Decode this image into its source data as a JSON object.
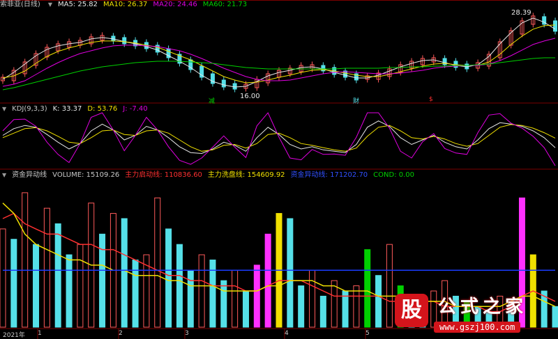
{
  "colors": {
    "bg": "#000000",
    "divider": "#7a0000",
    "grid": "#3a0000",
    "ma5": "#e8e8e8",
    "ma10": "#f0e000",
    "ma20": "#e000e0",
    "ma60": "#00d000",
    "up": "#ff5a5a",
    "down": "#55e0e8",
    "k": "#e8e8e8",
    "d": "#f0e000",
    "j": "#e000e0",
    "main_start": "#ff3030",
    "wash": "#f0e000",
    "fund": "#1a3cff",
    "cond": "#00d000"
  },
  "panel1": {
    "title": "索菲亚(日线)",
    "ma5": "MA5: 25.82",
    "ma10": "MA10: 26.37",
    "ma20": "MA20: 24.46",
    "ma60": "MA60: 21.73",
    "high_label": "28.39",
    "low_label": "16.00",
    "markers": [
      "减",
      "财",
      "$"
    ]
  },
  "panel2": {
    "title": "KDJ(9,3,3)",
    "k": "K: 33.37",
    "d": "D: 53.76",
    "j": "J: -7.40"
  },
  "panel3": {
    "title": "资金异动线",
    "volume": "VOLUME: 15109.26",
    "main_start": "主力启动线: 110836.60",
    "wash": "主力洗盘线: 154609.92",
    "fund": "资金异动线: 171202.70",
    "cond": "COND: 0.00"
  },
  "axis": {
    "labels": [
      "2021年",
      "1",
      "2",
      "3",
      "4",
      "5"
    ]
  },
  "watermark": {
    "logo_char": "股",
    "title": "公式之家",
    "url": "www.gszj100.com"
  },
  "chart_data": [
    {
      "type": "line",
      "title": "索菲亚(日线)",
      "price_range": [
        16.0,
        28.39
      ],
      "series": [
        {
          "name": "MA5",
          "values": [
            18.6,
            19.6,
            20.8,
            22.0,
            22.9,
            23.4,
            23.7,
            23.9,
            24.4,
            24.6,
            24.4,
            24.0,
            23.7,
            23.3,
            22.8,
            22.0,
            21.2,
            20.3,
            19.2,
            18.3,
            17.8,
            17.5,
            17.6,
            18.3,
            19.1,
            19.6,
            19.9,
            20.3,
            20.4,
            20.1,
            19.6,
            19.2,
            18.8,
            18.8,
            19.2,
            19.8,
            20.4,
            20.9,
            21.3,
            21.4,
            21.0,
            20.6,
            20.4,
            20.7,
            21.9,
            23.7,
            25.3,
            26.7,
            27.4,
            26.8,
            25.8
          ]
        },
        {
          "name": "MA10",
          "values": [
            18.8,
            19.1,
            19.8,
            20.9,
            21.9,
            22.6,
            23.1,
            23.5,
            23.9,
            24.1,
            24.1,
            24.0,
            23.8,
            23.5,
            23.2,
            22.6,
            22.0,
            21.4,
            20.6,
            19.8,
            19.0,
            18.5,
            18.1,
            18.2,
            18.5,
            18.9,
            19.2,
            19.6,
            19.9,
            20.0,
            19.8,
            19.5,
            19.2,
            19.0,
            19.0,
            19.3,
            19.7,
            20.1,
            20.5,
            20.8,
            20.9,
            20.7,
            20.6,
            20.6,
            21.1,
            22.2,
            23.6,
            24.8,
            25.8,
            26.3,
            26.4
          ]
        },
        {
          "name": "MA20",
          "values": [
            17.6,
            17.9,
            18.4,
            19.3,
            20.2,
            21.0,
            21.7,
            22.3,
            22.7,
            23.1,
            23.4,
            23.5,
            23.5,
            23.4,
            23.3,
            23.0,
            22.7,
            22.2,
            21.6,
            20.9,
            20.2,
            19.6,
            19.0,
            18.6,
            18.4,
            18.4,
            18.5,
            18.8,
            19.1,
            19.4,
            19.6,
            19.7,
            19.6,
            19.5,
            19.4,
            19.4,
            19.5,
            19.7,
            19.9,
            20.2,
            20.4,
            20.5,
            20.6,
            20.6,
            20.8,
            21.3,
            22.0,
            22.8,
            23.6,
            24.1,
            24.5
          ]
        },
        {
          "name": "MA60",
          "values": [
            17.1,
            17.4,
            17.8,
            18.2,
            18.6,
            19.0,
            19.4,
            19.8,
            20.1,
            20.4,
            20.6,
            20.8,
            21.0,
            21.1,
            21.2,
            21.2,
            21.2,
            21.1,
            21.0,
            20.9,
            20.7,
            20.5,
            20.3,
            20.2,
            20.1,
            20.1,
            20.1,
            20.1,
            20.1,
            20.1,
            20.1,
            20.2,
            20.2,
            20.2,
            20.2,
            20.3,
            20.3,
            20.4,
            20.4,
            20.5,
            20.5,
            20.6,
            20.6,
            20.7,
            20.8,
            21.0,
            21.2,
            21.4,
            21.6,
            21.7,
            21.7
          ]
        }
      ]
    },
    {
      "type": "line",
      "title": "KDJ(9,3,3)",
      "ylim": [
        -10,
        110
      ],
      "series": [
        {
          "name": "K",
          "values": [
            60,
            75,
            82,
            78,
            62,
            45,
            30,
            42,
            70,
            85,
            72,
            50,
            60,
            80,
            72,
            55,
            35,
            22,
            20,
            30,
            45,
            38,
            25,
            55,
            78,
            62,
            40,
            30,
            35,
            28,
            25,
            22,
            40,
            78,
            92,
            80,
            55,
            40,
            50,
            60,
            45,
            35,
            30,
            50,
            75,
            88,
            85,
            80,
            70,
            55,
            33
          ]
        },
        {
          "name": "D",
          "values": [
            55,
            65,
            75,
            77,
            70,
            58,
            45,
            42,
            55,
            70,
            72,
            62,
            60,
            70,
            72,
            65,
            50,
            35,
            25,
            28,
            38,
            40,
            32,
            42,
            62,
            65,
            55,
            42,
            38,
            33,
            28,
            25,
            32,
            58,
            78,
            82,
            70,
            55,
            52,
            58,
            52,
            42,
            36,
            42,
            60,
            78,
            84,
            82,
            76,
            66,
            54
          ]
        },
        {
          "name": "J",
          "values": [
            70,
            95,
            96,
            80,
            45,
            18,
            0,
            42,
            100,
            110,
            72,
            26,
            60,
            100,
            72,
            35,
            5,
            -4,
            10,
            34,
            59,
            34,
            11,
            81,
            110,
            56,
            10,
            6,
            29,
            18,
            19,
            16,
            56,
            110,
            110,
            76,
            25,
            10,
            46,
            64,
            31,
            21,
            18,
            66,
            105,
            108,
            87,
            76,
            58,
            33,
            -7
          ]
        }
      ]
    },
    {
      "type": "bar",
      "title": "资金异动线",
      "series": [
        {
          "name": "VOLUME",
          "values": [
            9.5,
            8.5,
            13.0,
            8.0,
            11.5,
            10.0,
            7.0,
            8.0,
            12.0,
            9.0,
            11.0,
            10.5,
            6.5,
            7.0,
            12.5,
            9.5,
            8.0,
            5.5,
            7.0,
            6.5,
            4.5,
            5.5,
            3.5,
            6.0,
            9.0,
            11.0,
            10.5,
            4.0,
            5.5,
            3.0,
            4.5,
            3.5,
            4.0,
            7.5,
            5.0,
            8.0,
            4.0,
            3.0,
            2.5,
            3.5,
            4.5,
            3.0,
            2.5,
            2.0,
            1.5,
            3.0,
            2.5,
            12.5,
            7.0,
            3.5,
            2.0
          ]
        },
        {
          "name": "主力启动线",
          "values": [
            10.5,
            11.0,
            10.0,
            9.5,
            9.0,
            9.0,
            8.5,
            8.0,
            8.0,
            7.5,
            7.5,
            7.0,
            6.5,
            6.0,
            5.5,
            5.0,
            5.0,
            4.5,
            4.5,
            4.0,
            4.0,
            4.0,
            3.5,
            3.5,
            4.0,
            4.5,
            4.5,
            4.5,
            4.0,
            3.5,
            3.0,
            3.0,
            3.0,
            3.0,
            3.0,
            2.5,
            2.5,
            2.5,
            2.5,
            2.5,
            2.0,
            2.0,
            2.0,
            2.0,
            1.5,
            1.5,
            2.0,
            3.0,
            3.5,
            3.0,
            2.5
          ]
        },
        {
          "name": "主力洗盘线",
          "values": [
            12.0,
            11.0,
            9.0,
            8.0,
            7.5,
            7.0,
            6.5,
            6.5,
            6.0,
            6.0,
            5.5,
            5.5,
            5.0,
            5.0,
            5.0,
            4.5,
            4.5,
            4.0,
            4.0,
            4.0,
            3.5,
            3.5,
            3.5,
            3.5,
            4.0,
            4.0,
            4.5,
            4.5,
            4.5,
            4.0,
            4.0,
            3.5,
            3.5,
            3.5,
            3.0,
            3.0,
            3.0,
            2.5,
            2.5,
            2.5,
            2.5,
            2.0,
            2.0,
            2.0,
            2.0,
            2.0,
            2.5,
            3.0,
            3.0,
            2.5,
            2.0
          ]
        },
        {
          "name": "资金异动线",
          "values": [
            5.5,
            5.5,
            5.5,
            5.5,
            5.5,
            5.5,
            5.5,
            5.5,
            5.5,
            5.5,
            5.5,
            5.5,
            5.5,
            5.5,
            5.5,
            5.5,
            5.5,
            5.5,
            5.5,
            5.5,
            5.5,
            5.5,
            5.5,
            5.5,
            5.5,
            5.5,
            5.5,
            5.5,
            5.5,
            5.5,
            5.5,
            5.5,
            5.5,
            5.5,
            5.5,
            5.5,
            5.5,
            5.5,
            5.5,
            5.5,
            5.5,
            5.5,
            5.5,
            5.5,
            5.5,
            5.5,
            5.5,
            5.5,
            5.5,
            5.5,
            5.5
          ]
        }
      ]
    }
  ]
}
